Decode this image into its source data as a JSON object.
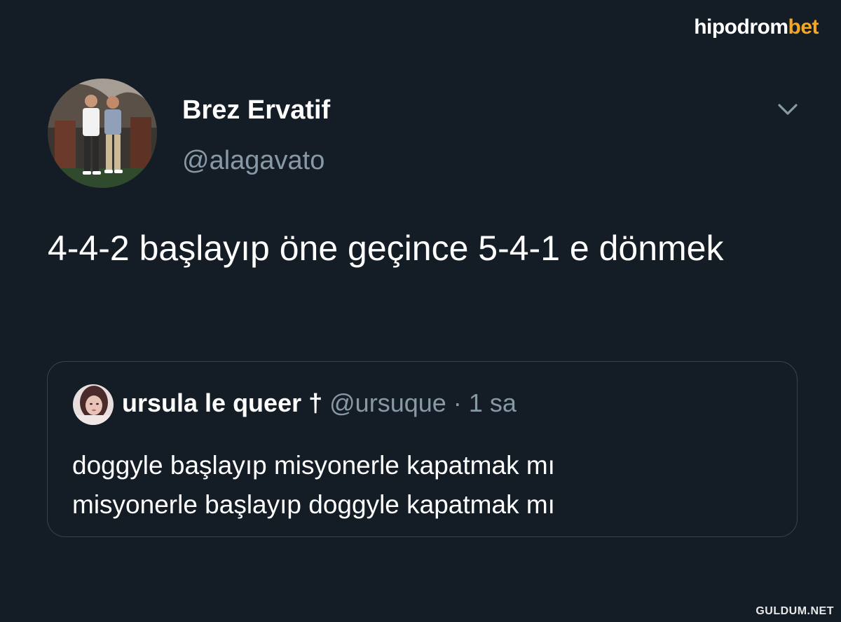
{
  "watermark": {
    "brand_main": "hipodrom",
    "brand_accent": "bet",
    "site": "GULDUM.NET"
  },
  "tweet": {
    "display_name": "Brez Ervatif",
    "handle": "@alagavato",
    "text": "4-4-2 başlayıp öne geçince 5-4-1 e dönmek"
  },
  "quoted_tweet": {
    "display_name": "ursula le queer †",
    "handle": "@ursuque",
    "separator": "·",
    "time": "1 sa",
    "lines": [
      "doggyle başlayıp misyonerle kapatmak mı",
      "misyonerle başlayıp doggyle kapatmak mı"
    ]
  },
  "colors": {
    "background": "#141d26",
    "text": "#ffffff",
    "secondary": "#8899a6",
    "border": "#38444d",
    "brand_accent": "#f5a623"
  },
  "icons": {
    "menu": "chevron-down-icon"
  }
}
